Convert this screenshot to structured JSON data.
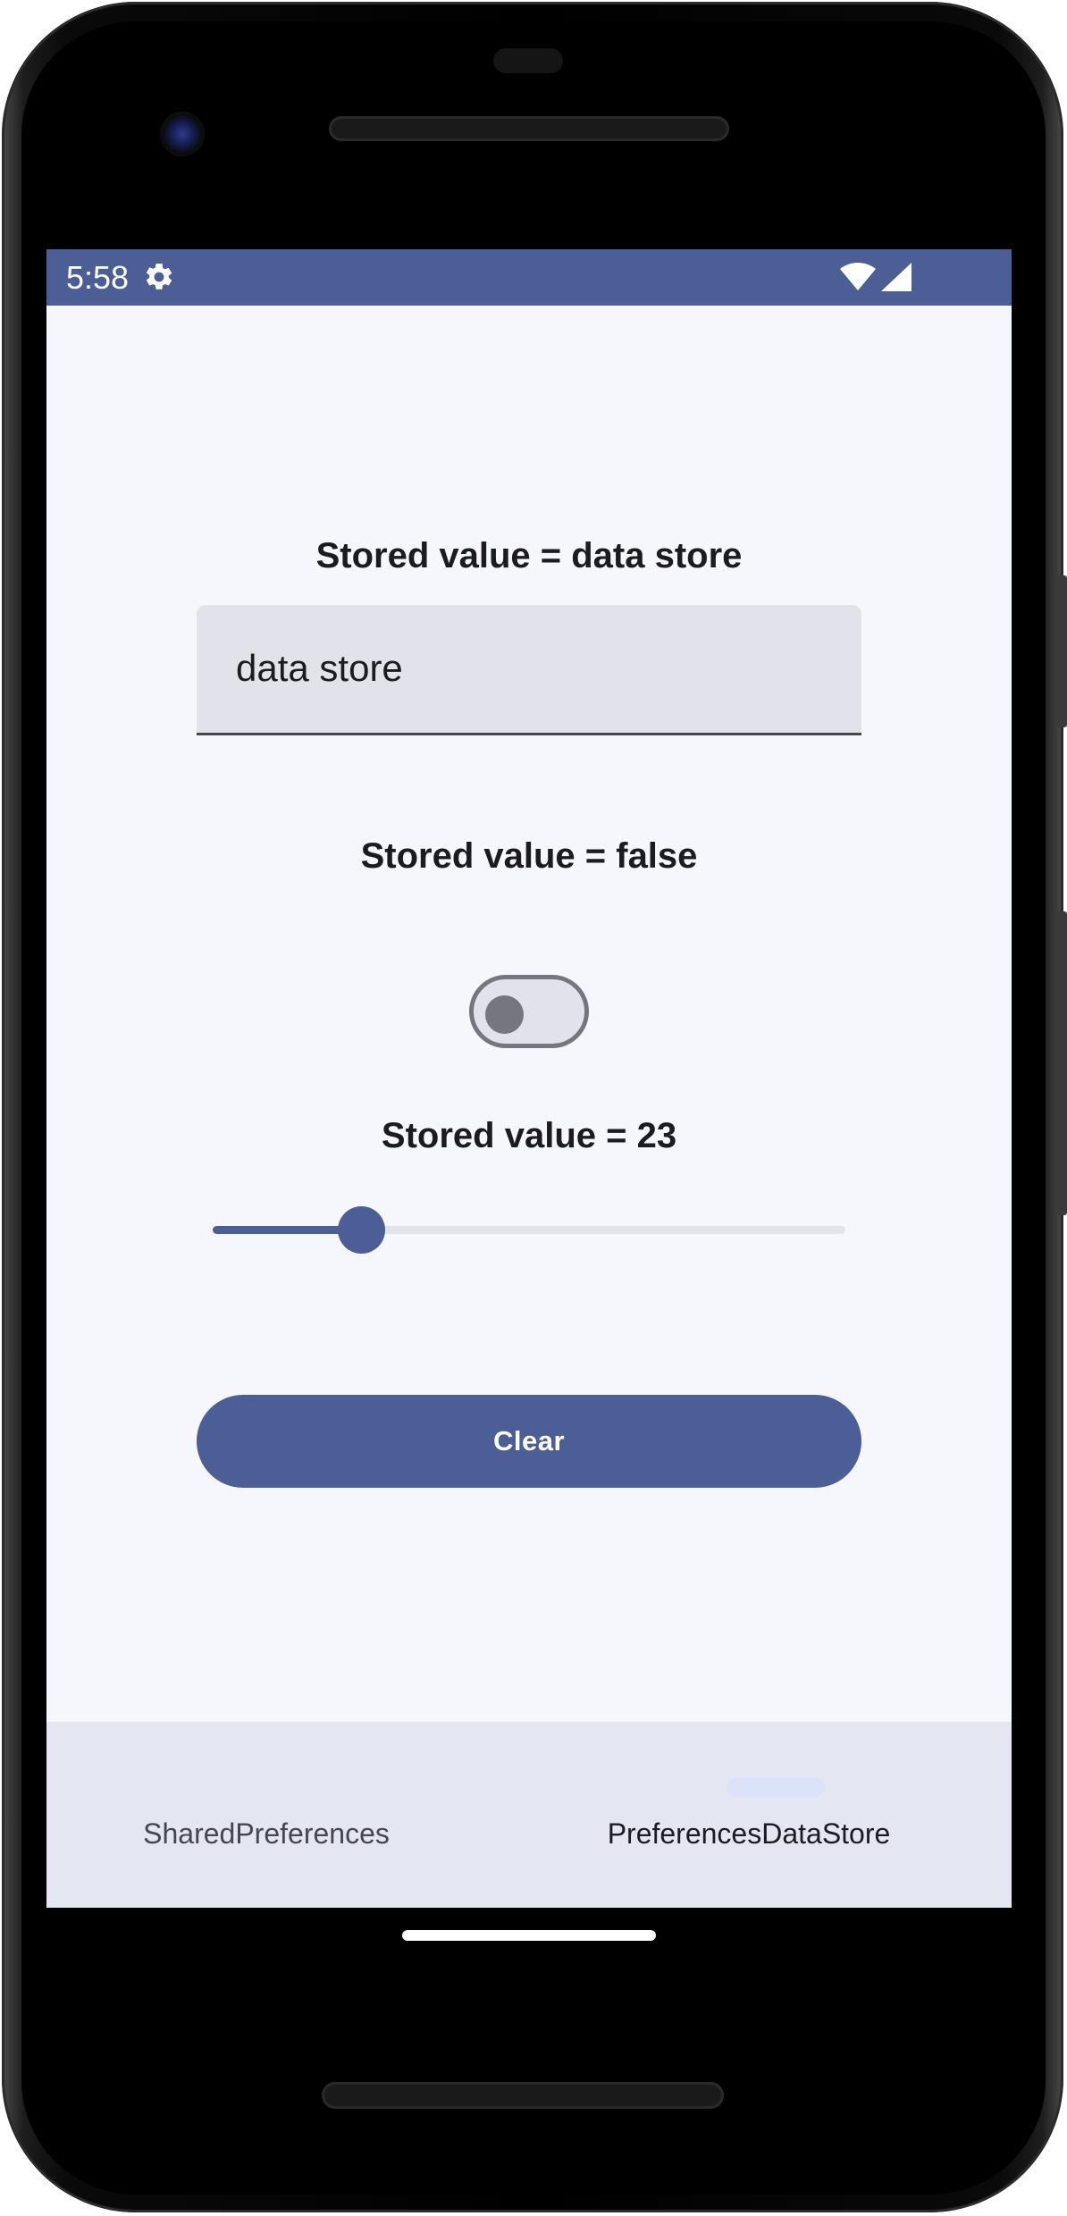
{
  "status_bar": {
    "time": "5:58",
    "settings_icon": "gear-icon",
    "wifi_icon": "wifi-icon",
    "signal_icon": "cell-signal-icon",
    "background": "#4b5e95"
  },
  "string_setting": {
    "label": "Stored value = data store",
    "input_value": "data store"
  },
  "boolean_setting": {
    "label": "Stored value = false",
    "switch_on": false
  },
  "number_setting": {
    "label": "Stored value = 23",
    "slider_fraction": 0.235
  },
  "actions": {
    "clear_label": "Clear"
  },
  "bottom_nav": {
    "items": [
      {
        "label": "SharedPreferences",
        "selected": false
      },
      {
        "label": "PreferencesDataStore",
        "selected": true
      }
    ]
  },
  "colors": {
    "primary": "#4b5e95",
    "surface": "#f6f7fc",
    "text_field_bg": "#e2e2ea",
    "nav_bar_bg": "#e4e6f1"
  }
}
